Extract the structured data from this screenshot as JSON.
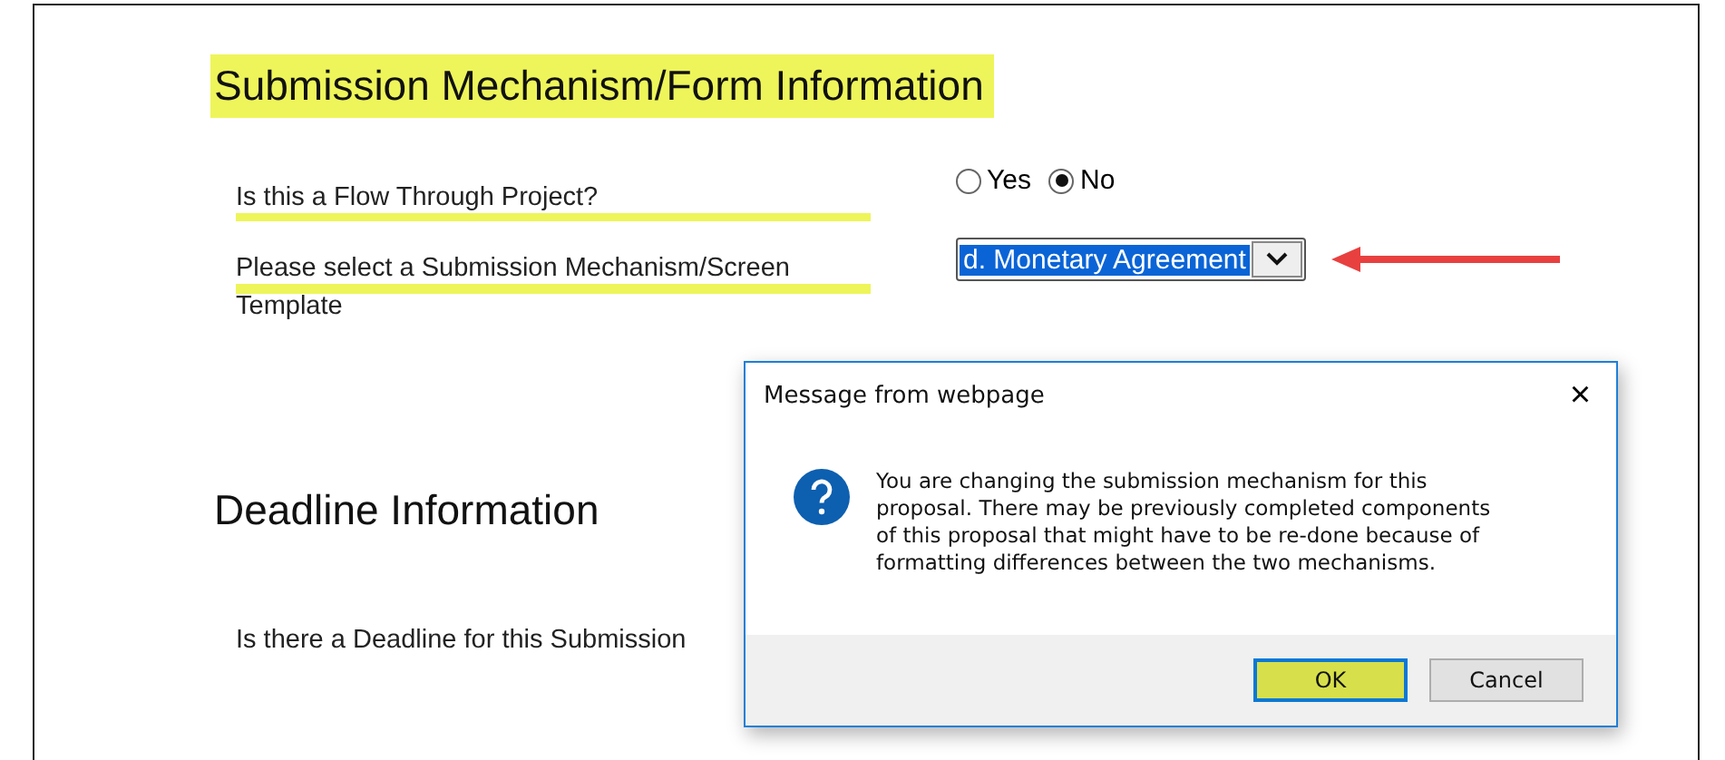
{
  "sections": [
    {
      "heading": "Submission Mechanism/Form Information",
      "highlighted": true,
      "fields": [
        {
          "kind": "radio",
          "label": "Is this a Flow Through Project?",
          "highlighted": true,
          "options": [
            {
              "label": "Yes",
              "selected": false
            },
            {
              "label": "No",
              "selected": true
            }
          ]
        },
        {
          "kind": "select",
          "label": "Please select a Submission Mechanism/Screen Template",
          "highlighted": true,
          "value": "d. Monetary Agreement",
          "arrow": true
        }
      ]
    },
    {
      "heading": "Deadline Information",
      "highlighted": false,
      "fields": [
        {
          "kind": "text",
          "label": "Is there a Deadline for this Submission",
          "highlighted": false
        }
      ]
    }
  ],
  "dialog": {
    "title": "Message from webpage",
    "close": "×",
    "message": "You are changing the submission mechanism for this proposal.  There may be previously completed components of this proposal that might have to be re-done because of formatting differences between the two mechanisms.",
    "buttons": [
      {
        "label": "OK",
        "highlighted": true
      },
      {
        "label": "Cancel",
        "highlighted": false
      }
    ]
  }
}
